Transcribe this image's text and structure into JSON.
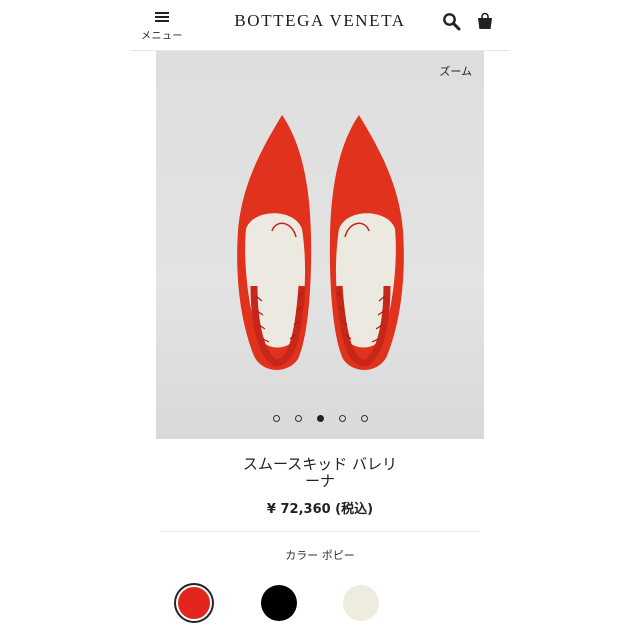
{
  "header": {
    "menu_label": "メニュー",
    "logo": "BOTTEGA VENETA",
    "icons": [
      "menu-icon",
      "search-icon",
      "shopping-bag-icon"
    ]
  },
  "gallery": {
    "zoom_label": "ズーム",
    "slide_count": 5,
    "active_slide": 3
  },
  "product": {
    "name_line1": "スムースキッド バレリ",
    "name_line2": "ーナ",
    "price": "¥ 72,360 (税込)",
    "color_label": "カラー ポピー"
  },
  "colors": {
    "swatches": [
      "#e2261d",
      "#000000",
      "#eeebdf"
    ],
    "selected": "#e2261d"
  }
}
